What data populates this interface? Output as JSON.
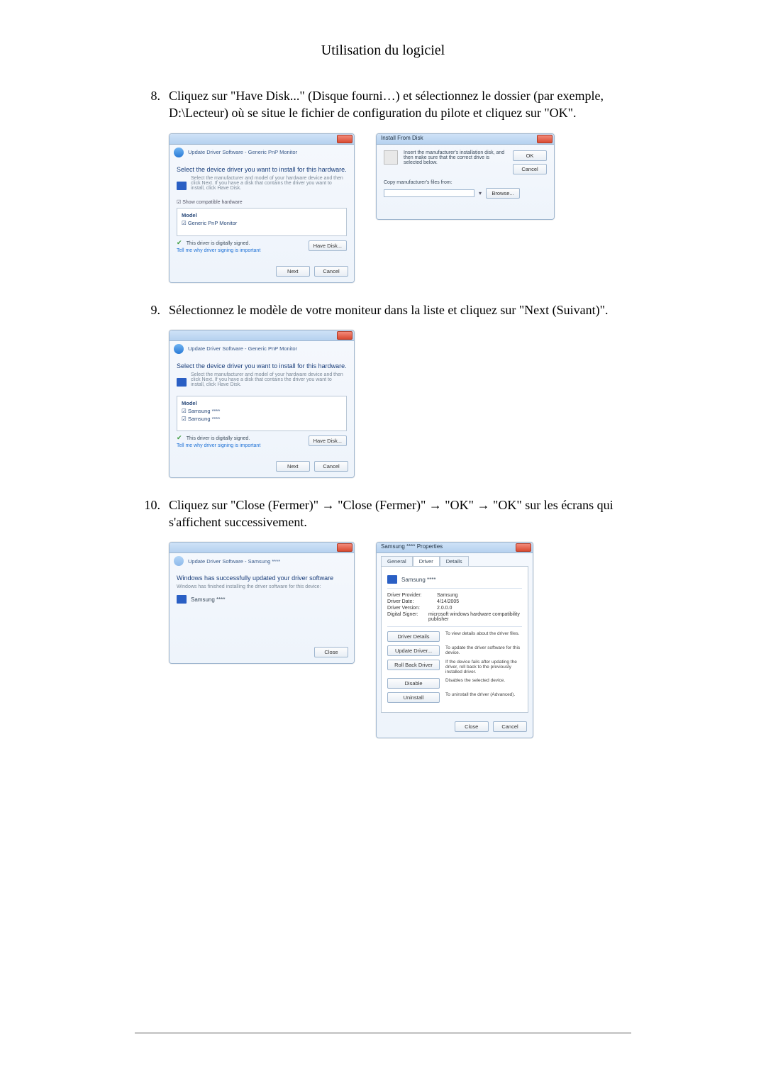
{
  "page_title": "Utilisation du logiciel",
  "steps": {
    "s8": {
      "num": "8.",
      "text": "Cliquez sur \"Have Disk...\" (Disque fourni…) et sélectionnez le dossier (par exemple, D:\\Lecteur) où se situe le fichier de configuration du pilote et cliquez sur \"OK\"."
    },
    "s9": {
      "num": "9.",
      "text": "Sélectionnez le modèle de votre moniteur dans la liste et cliquez sur \"Next (Suivant)\"."
    },
    "s10": {
      "num": "10.",
      "text": "Cliquez sur \"Close (Fermer)\" → \"Close (Fermer)\" → \"OK\" → \"OK\" sur les écrans qui s'affichent successivement."
    }
  },
  "win_update": {
    "breadcrumb": "Update Driver Software - Generic PnP Monitor",
    "heading": "Select the device driver you want to install for this hardware.",
    "sub": "Select the manufacturer and model of your hardware device and then click Next. If you have a disk that contains the driver you want to install, click Have Disk.",
    "chk_label": "Show compatible hardware",
    "col_model": "Model",
    "item1": "Generic PnP Monitor",
    "signed": "This driver is digitally signed.",
    "tell": "Tell me why driver signing is important",
    "btn_havedisk": "Have Disk...",
    "btn_next": "Next",
    "btn_cancel": "Cancel"
  },
  "win_havedisk": {
    "title": "Install From Disk",
    "msg": "Insert the manufacturer's installation disk, and then make sure that the correct drive is selected below.",
    "btn_ok": "OK",
    "btn_cancel": "Cancel",
    "copy_label": "Copy manufacturer's files from:",
    "btn_browse": "Browse..."
  },
  "win_update2": {
    "breadcrumb": "Update Driver Software - Generic PnP Monitor",
    "heading": "Select the device driver you want to install for this hardware.",
    "sub": "Select the manufacturer and model of your hardware device and then click Next. If you have a disk that contains the driver you want to install, click Have Disk.",
    "col_model": "Model",
    "item1": "Samsung ****",
    "item2": "Samsung ****",
    "signed": "This driver is digitally signed.",
    "tell": "Tell me why driver signing is important",
    "btn_havedisk": "Have Disk...",
    "btn_next": "Next",
    "btn_cancel": "Cancel"
  },
  "win_success": {
    "breadcrumb": "Update Driver Software - Samsung ****",
    "heading": "Windows has successfully updated your driver software",
    "sub": "Windows has finished installing the driver software for this device:",
    "device": "Samsung ****",
    "btn_close": "Close"
  },
  "win_props": {
    "title": "Samsung **** Properties",
    "tab_general": "General",
    "tab_driver": "Driver",
    "tab_details": "Details",
    "device": "Samsung ****",
    "kv": {
      "provider_k": "Driver Provider:",
      "provider_v": "Samsung",
      "date_k": "Driver Date:",
      "date_v": "4/14/2005",
      "version_k": "Driver Version:",
      "version_v": "2.0.0.0",
      "signer_k": "Digital Signer:",
      "signer_v": "microsoft windows hardware compatibility publisher"
    },
    "btns": {
      "details": "Driver Details",
      "details_d": "To view details about the driver files.",
      "update": "Update Driver...",
      "update_d": "To update the driver software for this device.",
      "rollback": "Roll Back Driver",
      "rollback_d": "If the device fails after updating the driver, roll back to the previously installed driver.",
      "disable": "Disable",
      "disable_d": "Disables the selected device.",
      "uninstall": "Uninstall",
      "uninstall_d": "To uninstall the driver (Advanced)."
    },
    "btn_close": "Close",
    "btn_cancel": "Cancel"
  }
}
